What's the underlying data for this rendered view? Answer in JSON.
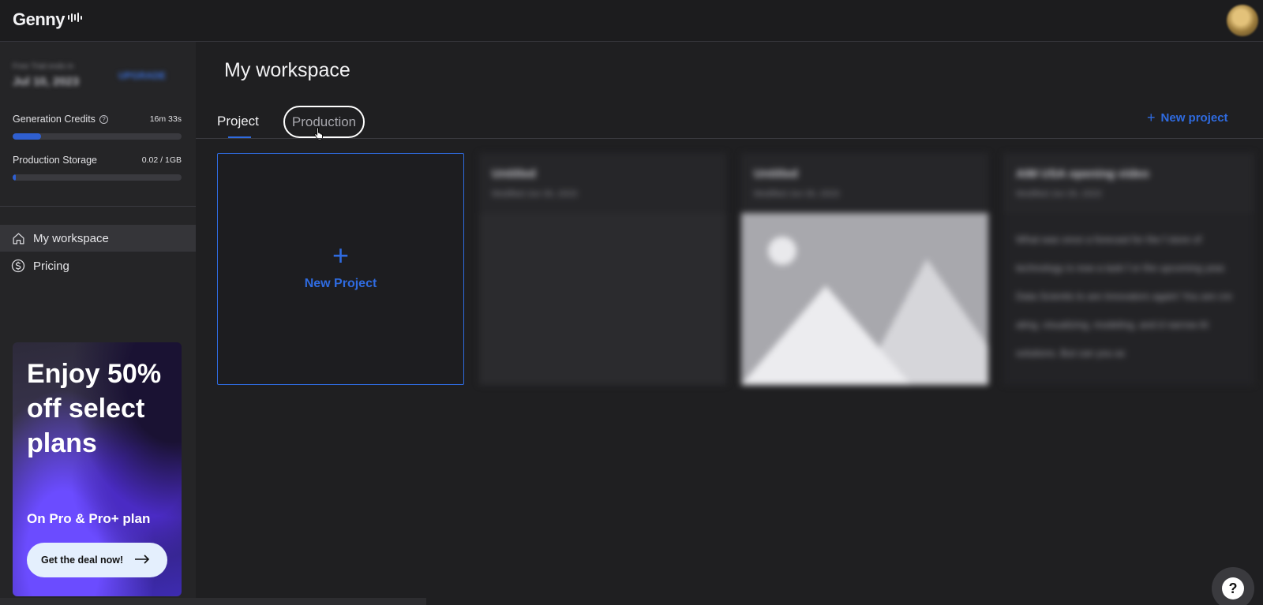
{
  "app": {
    "name": "Genny"
  },
  "sidebar": {
    "plan": {
      "label": "Free Trial ends in",
      "date": "Jul 10, 2023",
      "upgrade": "UPGRADE"
    },
    "generation_credits": {
      "label": "Generation Credits",
      "value": "16m 33s",
      "fill_fraction": 0.17
    },
    "production_storage": {
      "label": "Production Storage",
      "value": "0.02 / 1GB",
      "fill_fraction": 0.02
    },
    "nav": [
      {
        "label": "My workspace",
        "icon": "home-icon",
        "active": true
      },
      {
        "label": "Pricing",
        "icon": "dollar-circle-icon",
        "active": false
      }
    ],
    "promo": {
      "title": "Enjoy 50% off select plans",
      "subtitle": "On Pro & Pro+ plan",
      "button": "Get the deal now!"
    }
  },
  "main": {
    "title": "My workspace",
    "tabs": [
      {
        "label": "Project",
        "active": true
      },
      {
        "label": "Production",
        "active": false
      }
    ],
    "new_project_link": "New project",
    "new_project_card": "New Project",
    "cards": [
      {
        "title": "Untitled",
        "meta": "Modified Jun 30, 2023"
      },
      {
        "title": "Untitled",
        "meta": "Modified Jun 30, 2023"
      },
      {
        "title": "AIM USA opening video",
        "meta": "Modified Jun 30, 2023",
        "text": "What was once a forecast for the f store of technology is now a task f or the upcoming year. Data Scientis ts are innovators again! You are cre ating, visualizing, modeling, and d narrow AI solutions. But can you ac"
      }
    ]
  },
  "colors": {
    "accent": "#2f6be0",
    "background": "#1f1f21",
    "sidebar": "#252527"
  }
}
